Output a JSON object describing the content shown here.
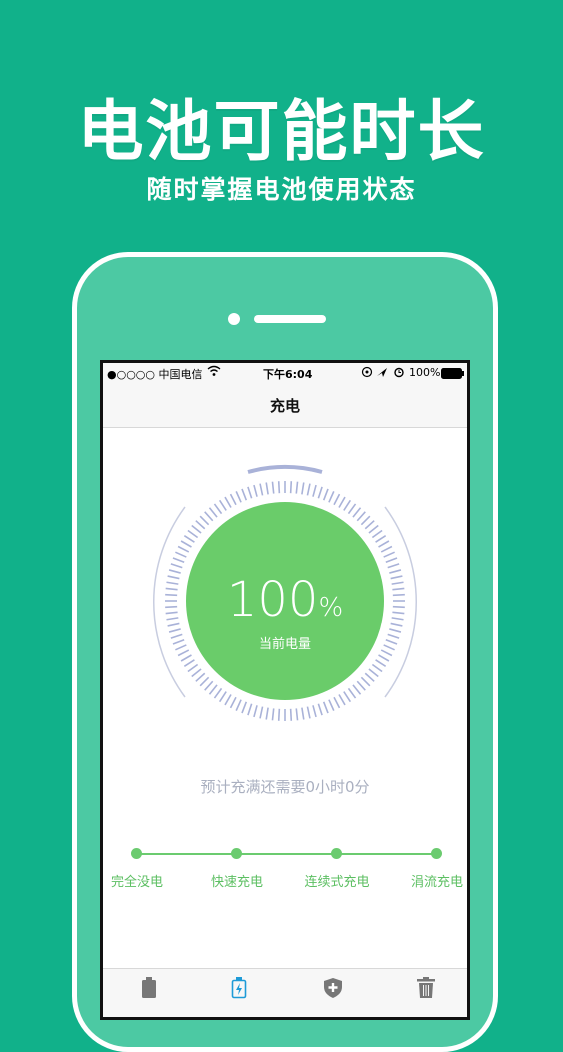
{
  "hero": {
    "title": "电池可能时长",
    "subtitle": "随时掌握电池使用状态"
  },
  "status_bar": {
    "carrier": "●○○○○ 中国电信",
    "time": "下午6:04",
    "battery": "100%"
  },
  "nav": {
    "title": "充电"
  },
  "gauge": {
    "level_percent": 100,
    "value": "100",
    "unit": "%",
    "label": "当前电量",
    "fill_color": "#6acc6a",
    "tick_color": "#a9b2d8"
  },
  "remaining_text": "预计充满还需要0小时0分",
  "stages": [
    {
      "label": "完全没电"
    },
    {
      "label": "快速充电"
    },
    {
      "label": "连续式充电"
    },
    {
      "label": "涓流充电"
    }
  ],
  "tabs": [
    {
      "icon": "battery-icon"
    },
    {
      "icon": "charging-icon",
      "active": true
    },
    {
      "icon": "shield-plus-icon"
    },
    {
      "icon": "trash-icon"
    }
  ],
  "colors": {
    "background": "#11b18a",
    "accent": "#6bcb6f"
  }
}
